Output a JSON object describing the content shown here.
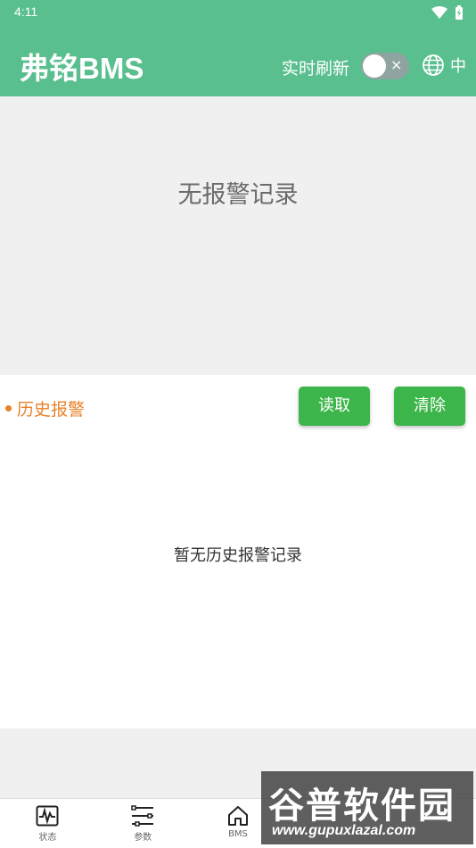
{
  "status_bar": {
    "time": "4:11"
  },
  "header": {
    "title": "弗铭BMS",
    "realtime_refresh_label": "实时刷新",
    "toggle_symbol": "×",
    "language_label": "中"
  },
  "alarm": {
    "empty_text": "无报警记录"
  },
  "history": {
    "title": "历史报警",
    "read_button": "读取",
    "clear_button": "清除",
    "empty_text": "暂无历史报警记录"
  },
  "nav": {
    "items": [
      {
        "label": "状态",
        "icon": "waveform-icon"
      },
      {
        "label": "参数",
        "icon": "settings-list-icon"
      },
      {
        "label": "BMS",
        "icon": "home-icon"
      }
    ]
  },
  "watermark": {
    "main": "谷普软件园",
    "url": "www.gupuxlazal.com"
  },
  "colors": {
    "header_bg": "#5abf8f",
    "button_green": "#3cb54a",
    "history_orange": "#e8822a"
  }
}
